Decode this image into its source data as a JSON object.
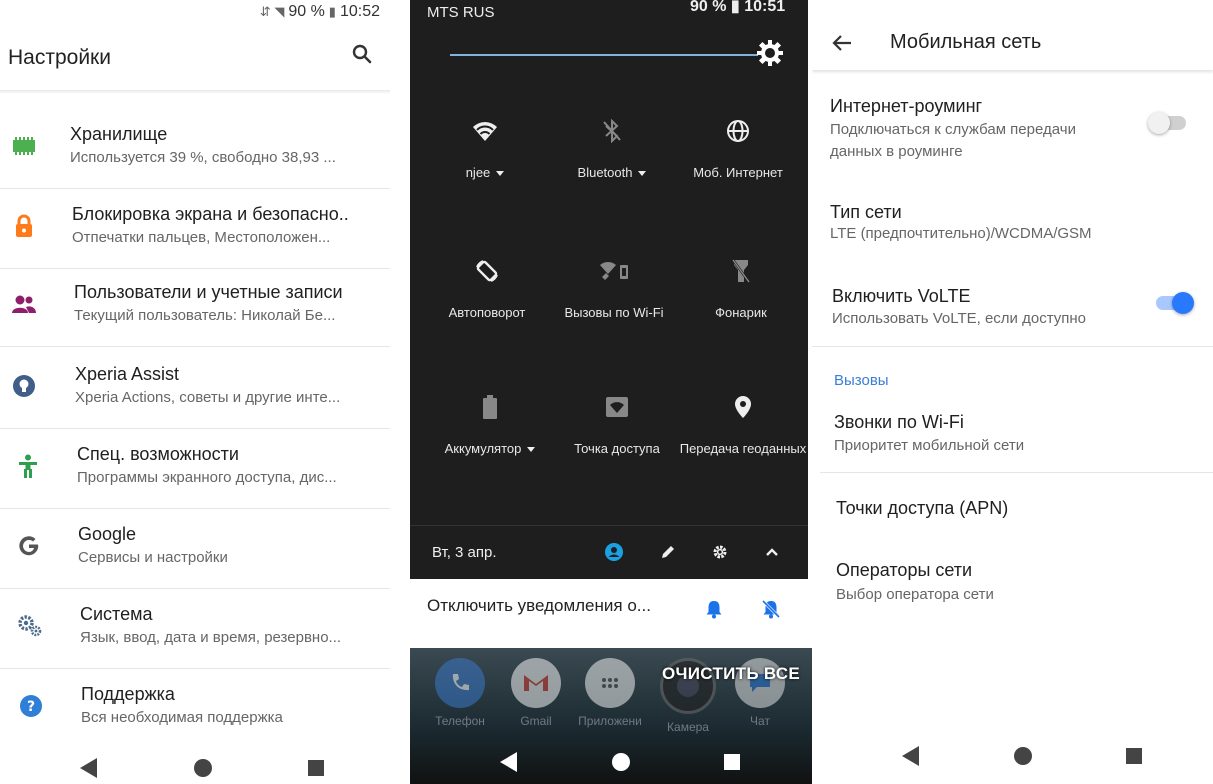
{
  "settings": {
    "status_battery": "90 %",
    "status_time": "10:52",
    "title": "Настройки",
    "items": [
      {
        "title": "Хранилище",
        "subtitle": "Используется 39 %, свободно 38,93 ...",
        "icon": "storage-icon",
        "color": "#4caf50"
      },
      {
        "title": "Блокировка экрана и безопасно..",
        "subtitle": "Отпечатки пальцев, Местоположен...",
        "icon": "lock-icon",
        "color": "#ff7a1a"
      },
      {
        "title": "Пользователи и учетные записи",
        "subtitle": "Текущий пользователь: Николай Бе...",
        "icon": "users-icon",
        "color": "#8e1f6c"
      },
      {
        "title": "Xperia Assist",
        "subtitle": "Xperia Actions, советы и другие инте...",
        "icon": "lightbulb-icon",
        "color": "#3f5f8a"
      },
      {
        "title": "Спец. возможности",
        "subtitle": "Программы экранного доступа, дис...",
        "icon": "accessibility-icon",
        "color": "#2e9e4f"
      },
      {
        "title": "Google",
        "subtitle": "Сервисы и настройки",
        "icon": "google-icon",
        "color": "#555555"
      },
      {
        "title": "Система",
        "subtitle": "Язык, ввод, дата и время, резервно...",
        "icon": "system-gears-icon",
        "color": "#4a6a8a"
      },
      {
        "title": "Поддержка",
        "subtitle": "Вся необходимая поддержка",
        "icon": "help-icon",
        "color": "#2f7fd6"
      }
    ]
  },
  "quick": {
    "carrier": "MTS RUS",
    "status_battery": "90 %",
    "status_time": "10:51",
    "tiles": [
      {
        "label": "njee",
        "dropdown": true,
        "icon": "wifi-icon"
      },
      {
        "label": "Bluetooth",
        "dropdown": true,
        "icon": "bluetooth-off-icon"
      },
      {
        "label": "Моб. Интернет",
        "dropdown": false,
        "icon": "globe-icon"
      },
      {
        "label": "Автоповорот",
        "dropdown": false,
        "icon": "auto-rotate-icon"
      },
      {
        "label": "Вызовы по Wi-Fi",
        "dropdown": false,
        "icon": "wifi-calling-icon"
      },
      {
        "label": "Фонарик",
        "dropdown": false,
        "icon": "flashlight-icon"
      },
      {
        "label": "Аккумулятор",
        "dropdown": true,
        "icon": "battery-icon"
      },
      {
        "label": "Точка доступа",
        "dropdown": false,
        "icon": "hotspot-icon"
      },
      {
        "label": "Передача геоданных",
        "dropdown": false,
        "icon": "location-icon"
      }
    ],
    "date": "Вт, 3 апр.",
    "notification": "Отключить уведомления о...",
    "clear_all": "ОЧИСТИТЬ ВСЕ",
    "dock": [
      {
        "label": "Телефон",
        "icon": "phone-icon"
      },
      {
        "label": "Gmail",
        "icon": "gmail-icon"
      },
      {
        "label": "Приложени",
        "icon": "apps-icon"
      },
      {
        "label": "Камера",
        "icon": "camera-icon"
      },
      {
        "label": "Чат",
        "icon": "chat-icon"
      }
    ],
    "accent": "#1ba1e2"
  },
  "mobile": {
    "title": "Мобильная сеть",
    "roaming_title": "Интернет-роуминг",
    "roaming_sub": "Подключаться к службам передачи данных в роуминге",
    "roaming_on": false,
    "network_type_title": "Тип сети",
    "network_type_value": "LTE (предпочтительно)/WCDMA/GSM",
    "volte_title": "Включить VoLTE",
    "volte_sub": "Использовать VoLTE, если доступно",
    "volte_on": true,
    "section_calls": "Вызовы",
    "wifi_calls_title": "Звонки по Wi-Fi",
    "wifi_calls_sub": "Приоритет мобильной сети",
    "apn_title": "Точки доступа (APN)",
    "operators_title": "Операторы сети",
    "operators_sub": "Выбор оператора сети",
    "accent": "#2979ff"
  }
}
